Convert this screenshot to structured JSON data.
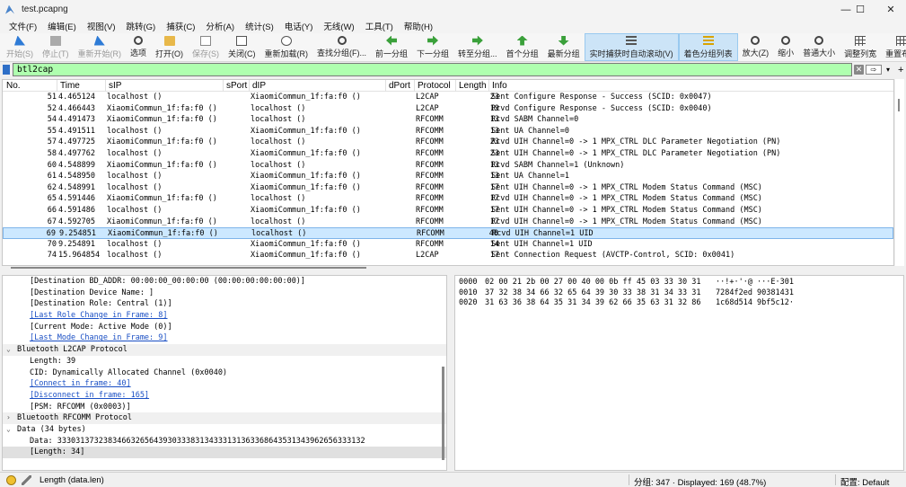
{
  "window": {
    "title": "test.pcapng",
    "controls": {
      "minimize": "—",
      "maximize": "☐",
      "close": "✕"
    }
  },
  "menu": [
    "文件(F)",
    "编辑(E)",
    "视图(V)",
    "跳转(G)",
    "捕获(C)",
    "分析(A)",
    "统计(S)",
    "电话(Y)",
    "无线(W)",
    "工具(T)",
    "帮助(H)"
  ],
  "toolbar": [
    {
      "label": "开始(S)",
      "icon": "shark-fin-icon",
      "state": "disabled"
    },
    {
      "label": "停止(T)",
      "icon": "stop-icon",
      "state": "disabled"
    },
    {
      "label": "重新开始(R)",
      "icon": "restart-icon",
      "state": "disabled"
    },
    {
      "label": "选项",
      "icon": "gear-icon",
      "state": "normal"
    },
    {
      "label": "打开(O)",
      "icon": "folder-icon",
      "state": "normal"
    },
    {
      "label": "保存(S)",
      "icon": "save-icon",
      "state": "disabled"
    },
    {
      "label": "关闭(C)",
      "icon": "close-file-icon",
      "state": "normal"
    },
    {
      "label": "重新加载(R)",
      "icon": "reload-icon",
      "state": "normal"
    },
    {
      "label": "查找分组(F)...",
      "icon": "search-icon",
      "state": "normal"
    },
    {
      "label": "前一分组",
      "icon": "back-arrow-icon",
      "state": "normal"
    },
    {
      "label": "下一分组",
      "icon": "forward-arrow-icon",
      "state": "normal"
    },
    {
      "label": "转至分组...",
      "icon": "goto-icon",
      "state": "normal"
    },
    {
      "label": "首个分组",
      "icon": "first-packet-icon",
      "state": "normal"
    },
    {
      "label": "最新分组",
      "icon": "last-packet-icon",
      "state": "normal"
    },
    {
      "label": "实时捕获时自动滚动(V)",
      "icon": "autoscroll-icon",
      "state": "active"
    },
    {
      "label": "着色分组列表",
      "icon": "colorize-icon",
      "state": "active"
    },
    {
      "label": "放大(Z)",
      "icon": "zoom-in-icon",
      "state": "normal"
    },
    {
      "label": "缩小",
      "icon": "zoom-out-icon",
      "state": "normal"
    },
    {
      "label": "普通大小",
      "icon": "zoom-normal-icon",
      "state": "normal"
    },
    {
      "label": "调整列宽",
      "icon": "resize-columns-icon",
      "state": "normal"
    },
    {
      "label": "重置布局",
      "icon": "reset-layout-icon",
      "state": "normal"
    }
  ],
  "filter": {
    "value": "btl2cap",
    "clear": "✕",
    "apply": "⇨",
    "dropdown": "▾",
    "add": "+"
  },
  "packet_list": {
    "columns": [
      "No.",
      "Time",
      "sIP",
      "sPort",
      "dIP",
      "dPort",
      "Protocol",
      "Length",
      "Info"
    ],
    "rows": [
      {
        "no": "51",
        "time": "4.465124",
        "sip": "localhost ()",
        "dip": "XiaomiCommun_1f:fa:f0 ()",
        "proto": "L2CAP",
        "len": "23",
        "info": "Sent Configure Response - Success (SCID: 0x0047)"
      },
      {
        "no": "52",
        "time": "4.466443",
        "sip": "XiaomiCommun_1f:fa:f0 ()",
        "dip": "localhost ()",
        "proto": "L2CAP",
        "len": "19",
        "info": "Rcvd Configure Response - Success (SCID: 0x0040)"
      },
      {
        "no": "54",
        "time": "4.491473",
        "sip": "XiaomiCommun_1f:fa:f0 ()",
        "dip": "localhost ()",
        "proto": "RFCOMM",
        "len": "13",
        "info": "Rcvd SABM Channel=0"
      },
      {
        "no": "55",
        "time": "4.491511",
        "sip": "localhost ()",
        "dip": "XiaomiCommun_1f:fa:f0 ()",
        "proto": "RFCOMM",
        "len": "13",
        "info": "Sent UA Channel=0"
      },
      {
        "no": "57",
        "time": "4.497725",
        "sip": "XiaomiCommun_1f:fa:f0 ()",
        "dip": "localhost ()",
        "proto": "RFCOMM",
        "len": "23",
        "info": "Rcvd UIH Channel=0 -> 1 MPX_CTRL DLC Parameter Negotiation (PN)"
      },
      {
        "no": "58",
        "time": "4.497762",
        "sip": "localhost ()",
        "dip": "XiaomiCommun_1f:fa:f0 ()",
        "proto": "RFCOMM",
        "len": "23",
        "info": "Sent UIH Channel=0 -> 1 MPX_CTRL DLC Parameter Negotiation (PN)"
      },
      {
        "no": "60",
        "time": "4.548899",
        "sip": "XiaomiCommun_1f:fa:f0 ()",
        "dip": "localhost ()",
        "proto": "RFCOMM",
        "len": "13",
        "info": "Rcvd SABM Channel=1 (Unknown)"
      },
      {
        "no": "61",
        "time": "4.548950",
        "sip": "localhost ()",
        "dip": "XiaomiCommun_1f:fa:f0 ()",
        "proto": "RFCOMM",
        "len": "13",
        "info": "Sent UA Channel=1"
      },
      {
        "no": "62",
        "time": "4.548991",
        "sip": "localhost ()",
        "dip": "XiaomiCommun_1f:fa:f0 ()",
        "proto": "RFCOMM",
        "len": "17",
        "info": "Sent UIH Channel=0 -> 1 MPX_CTRL Modem Status Command (MSC)"
      },
      {
        "no": "65",
        "time": "4.591446",
        "sip": "XiaomiCommun_1f:fa:f0 ()",
        "dip": "localhost ()",
        "proto": "RFCOMM",
        "len": "17",
        "info": "Rcvd UIH Channel=0 -> 1 MPX_CTRL Modem Status Command (MSC)"
      },
      {
        "no": "66",
        "time": "4.591486",
        "sip": "localhost ()",
        "dip": "XiaomiCommun_1f:fa:f0 ()",
        "proto": "RFCOMM",
        "len": "17",
        "info": "Sent UIH Channel=0 -> 1 MPX_CTRL Modem Status Command (MSC)"
      },
      {
        "no": "67",
        "time": "4.592705",
        "sip": "XiaomiCommun_1f:fa:f0 ()",
        "dip": "localhost ()",
        "proto": "RFCOMM",
        "len": "17",
        "info": "Rcvd UIH Channel=0 -> 1 MPX_CTRL Modem Status Command (MSC)"
      },
      {
        "no": "69",
        "time": "9.254851",
        "sip": "XiaomiCommun_1f:fa:f0 ()",
        "dip": "localhost ()",
        "proto": "RFCOMM",
        "len": "48",
        "info": "Rcvd UIH Channel=1 UID",
        "selected": true
      },
      {
        "no": "70",
        "time": "9.254891",
        "sip": "localhost ()",
        "dip": "XiaomiCommun_1f:fa:f0 ()",
        "proto": "RFCOMM",
        "len": "14",
        "info": "Sent UIH Channel=1 UID"
      },
      {
        "no": "74",
        "time": "15.964854",
        "sip": "localhost ()",
        "dip": "XiaomiCommun_1f:fa:f0 ()",
        "proto": "L2CAP",
        "len": "17",
        "info": "Sent Connection Request (AVCTP-Control, SCID: 0x0041)"
      }
    ]
  },
  "details": [
    {
      "text": "[Destination BD_ADDR: 00:00:00_00:00:00 (00:00:00:00:00:00)]",
      "indent": 2
    },
    {
      "text": "[Destination Device Name: ]",
      "indent": 2
    },
    {
      "text": "[Destination Role: Central (1)]",
      "indent": 2
    },
    {
      "text": "[Last Role Change in Frame: 8]",
      "indent": 2,
      "link": true
    },
    {
      "text": "[Current Mode: Active Mode (0)]",
      "indent": 2
    },
    {
      "text": "[Last Mode Change in Frame: 9]",
      "indent": 2,
      "link": true
    },
    {
      "text": "Bluetooth L2CAP Protocol",
      "indent": 1,
      "twisty": "⌄",
      "header": true
    },
    {
      "text": "Length: 39",
      "indent": 2
    },
    {
      "text": "CID: Dynamically Allocated Channel (0x0040)",
      "indent": 2
    },
    {
      "text": "[Connect in frame: 40]",
      "indent": 2,
      "link": true
    },
    {
      "text": "[Disconnect in frame: 165]",
      "indent": 2,
      "link": true
    },
    {
      "text": "[PSM: RFCOMM (0x0003)]",
      "indent": 2
    },
    {
      "text": "Bluetooth RFCOMM Protocol",
      "indent": 1,
      "twisty": "›",
      "header": true
    },
    {
      "text": "Data (34 bytes)",
      "indent": 1,
      "twisty": "⌄"
    },
    {
      "text": "Data: 3330313732383466326564393033383134333131363368643531343962656333132",
      "indent": 2
    },
    {
      "text": "[Length: 34]",
      "indent": 2,
      "selected": true
    }
  ],
  "bytes": [
    {
      "offset": "0000",
      "hex": "02 00 21 2b 00 27 00 40  00 0b ff 45 03 33 30 31",
      "ascii": "··!+·'·@ ···E·301"
    },
    {
      "offset": "0010",
      "hex": "37 32 38 34 66 32 65 64  39 30 33 38 31 34 33 31",
      "ascii": "7284f2ed 90381431"
    },
    {
      "offset": "0020",
      "hex": "31 63 36 38 64 35 31 34  39 62 66 35 63 31 32 86",
      "ascii": "1c68d514 9bf5c12·"
    }
  ],
  "status": {
    "field": "Length (data.len)",
    "packets": "分组: 347 · Displayed: 169 (48.7%)",
    "profile": "配置: Default"
  }
}
